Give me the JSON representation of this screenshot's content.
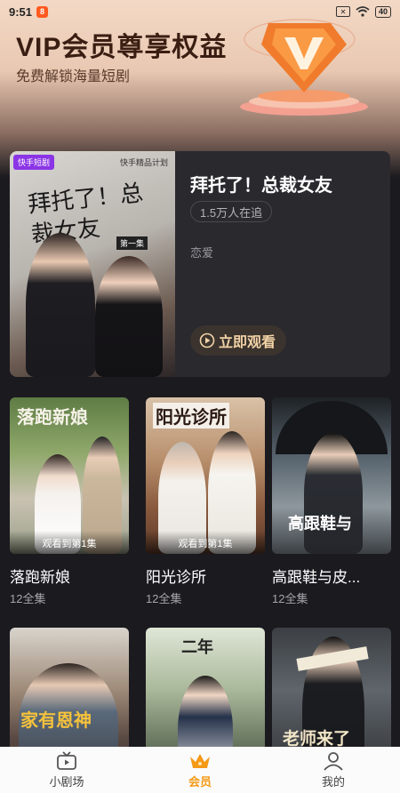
{
  "status_bar": {
    "time": "9:51",
    "app_badge": "8",
    "battery": "40"
  },
  "header": {
    "title": "VIP会员尊享权益",
    "subtitle": "免费解锁海量短剧",
    "emblem_letter": "V"
  },
  "featured": {
    "poster_brand": "快手短剧",
    "poster_studio": "快手精品计划",
    "poster_title": "拜托了！总裁女友",
    "poster_episode_tag": "第一集",
    "title": "拜托了！总裁女友",
    "followers": "1.5万人在追",
    "genre": "恋爱",
    "watch_label": "立即观看"
  },
  "dramas": [
    {
      "title": "落跑新娘",
      "episodes": "12全集",
      "progress": "观看到第1集",
      "poster_caption": "落跑新娘"
    },
    {
      "title": "阳光诊所",
      "episodes": "12全集",
      "progress": "观看到第1集",
      "poster_caption": "阳光诊所"
    },
    {
      "title": "高跟鞋与皮...",
      "episodes": "12全集",
      "progress": "",
      "poster_caption": "高跟鞋与"
    },
    {
      "title": "",
      "episodes": "",
      "progress": "",
      "poster_caption": "家有恩神"
    },
    {
      "title": "",
      "episodes": "",
      "progress": "",
      "poster_caption": "二年"
    },
    {
      "title": "",
      "episodes": "",
      "progress": "",
      "poster_caption": "老师来了"
    }
  ],
  "tabs": [
    {
      "label": "小剧场",
      "icon": "tv-icon",
      "active": false
    },
    {
      "label": "会员",
      "icon": "crown-icon",
      "active": true
    },
    {
      "label": "我的",
      "icon": "person-icon",
      "active": false
    }
  ],
  "colors": {
    "accent": "#f49a16",
    "button_text": "#f2d3a6",
    "background": "#1b1a1f"
  }
}
